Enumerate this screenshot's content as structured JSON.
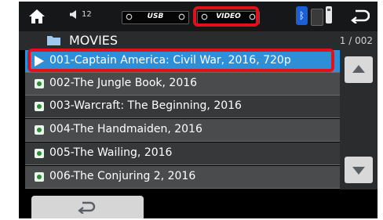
{
  "status_bar": {
    "volume_level": "12",
    "sources": [
      {
        "label": "USB",
        "active": false
      },
      {
        "label": "VIDEO",
        "active": true
      }
    ],
    "icons": [
      "home-icon",
      "volume-icon",
      "bluetooth-icon",
      "phone-icon",
      "usb-device-icon",
      "back-icon"
    ]
  },
  "folder": {
    "name": "MOVIES",
    "page": "1 / 002"
  },
  "files": [
    {
      "title": "001-Captain America: Civil War, 2016, 720p",
      "playing": true
    },
    {
      "title": "002-The Jungle Book, 2016",
      "playing": false
    },
    {
      "title": "003-Warcraft: The Beginning, 2016",
      "playing": false
    },
    {
      "title": "004-The Handmaiden, 2016",
      "playing": false
    },
    {
      "title": "005-The Wailing, 2016",
      "playing": false
    },
    {
      "title": "006-The Conjuring 2, 2016",
      "playing": false
    }
  ],
  "colors": {
    "highlight_border": "#e3101b",
    "selected_row": "#2f8fd6",
    "bluetooth": "#1c5fd4"
  }
}
